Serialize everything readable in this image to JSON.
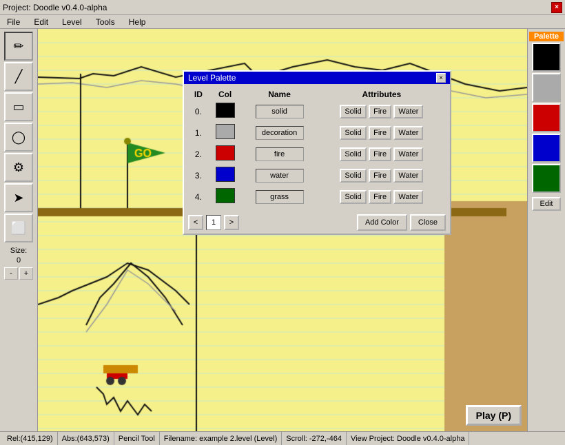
{
  "window": {
    "title": "Project: Doodle v0.4.0-alpha",
    "close_icon": "×"
  },
  "menu": {
    "items": [
      "File",
      "Edit",
      "Level",
      "Tools",
      "Help"
    ]
  },
  "toolbar": {
    "tools": [
      {
        "name": "pencil",
        "icon": "✏",
        "label": "Pencil"
      },
      {
        "name": "line",
        "icon": "⟋",
        "label": "Line"
      },
      {
        "name": "rect",
        "icon": "▭",
        "label": "Rectangle"
      },
      {
        "name": "ellipse",
        "icon": "◯",
        "label": "Ellipse"
      },
      {
        "name": "doodad",
        "icon": "⚙",
        "label": "Doodad"
      },
      {
        "name": "actor",
        "icon": "➤",
        "label": "Actor"
      },
      {
        "name": "erase",
        "icon": "⬜",
        "label": "Erase"
      }
    ],
    "size_label": "Size:",
    "size_value": "0",
    "minus_label": "-",
    "plus_label": "+"
  },
  "palette": {
    "header": "Palette",
    "swatches": [
      {
        "color": "#000000"
      },
      {
        "color": "#aaaaaa"
      },
      {
        "color": "#cc0000"
      },
      {
        "color": "#0000cc"
      },
      {
        "color": "#006600"
      }
    ],
    "edit_label": "Edit"
  },
  "dialog": {
    "title": "Level Palette",
    "close_icon": "×",
    "columns": [
      "ID",
      "Col",
      "Name",
      "Attributes"
    ],
    "rows": [
      {
        "id": "0.",
        "color": "#000000",
        "name": "solid",
        "attrs": [
          "Solid",
          "Fire",
          "Water"
        ]
      },
      {
        "id": "1.",
        "color": "#aaaaaa",
        "name": "decoration",
        "attrs": [
          "Solid",
          "Fire",
          "Water"
        ]
      },
      {
        "id": "2.",
        "color": "#cc0000",
        "name": "fire",
        "attrs": [
          "Solid",
          "Fire",
          "Water"
        ]
      },
      {
        "id": "3.",
        "color": "#0000cc",
        "name": "water",
        "attrs": [
          "Solid",
          "Fire",
          "Water"
        ]
      },
      {
        "id": "4.",
        "color": "#006600",
        "name": "grass",
        "attrs": [
          "Solid",
          "Fire",
          "Water"
        ]
      }
    ],
    "nav": {
      "prev": "<",
      "page": "1",
      "next": ">"
    },
    "add_color": "Add Color",
    "close": "Close"
  },
  "status": {
    "rel": "Rel:(415,129)",
    "abs": "Abs:(643,573)",
    "tool": "Pencil Tool",
    "filename": "Filename: example 2.level (Level)",
    "scroll": "Scroll: -272,-464",
    "project": "View Project: Doodle v0.4.0-alpha"
  },
  "play_btn": "Play (P)"
}
